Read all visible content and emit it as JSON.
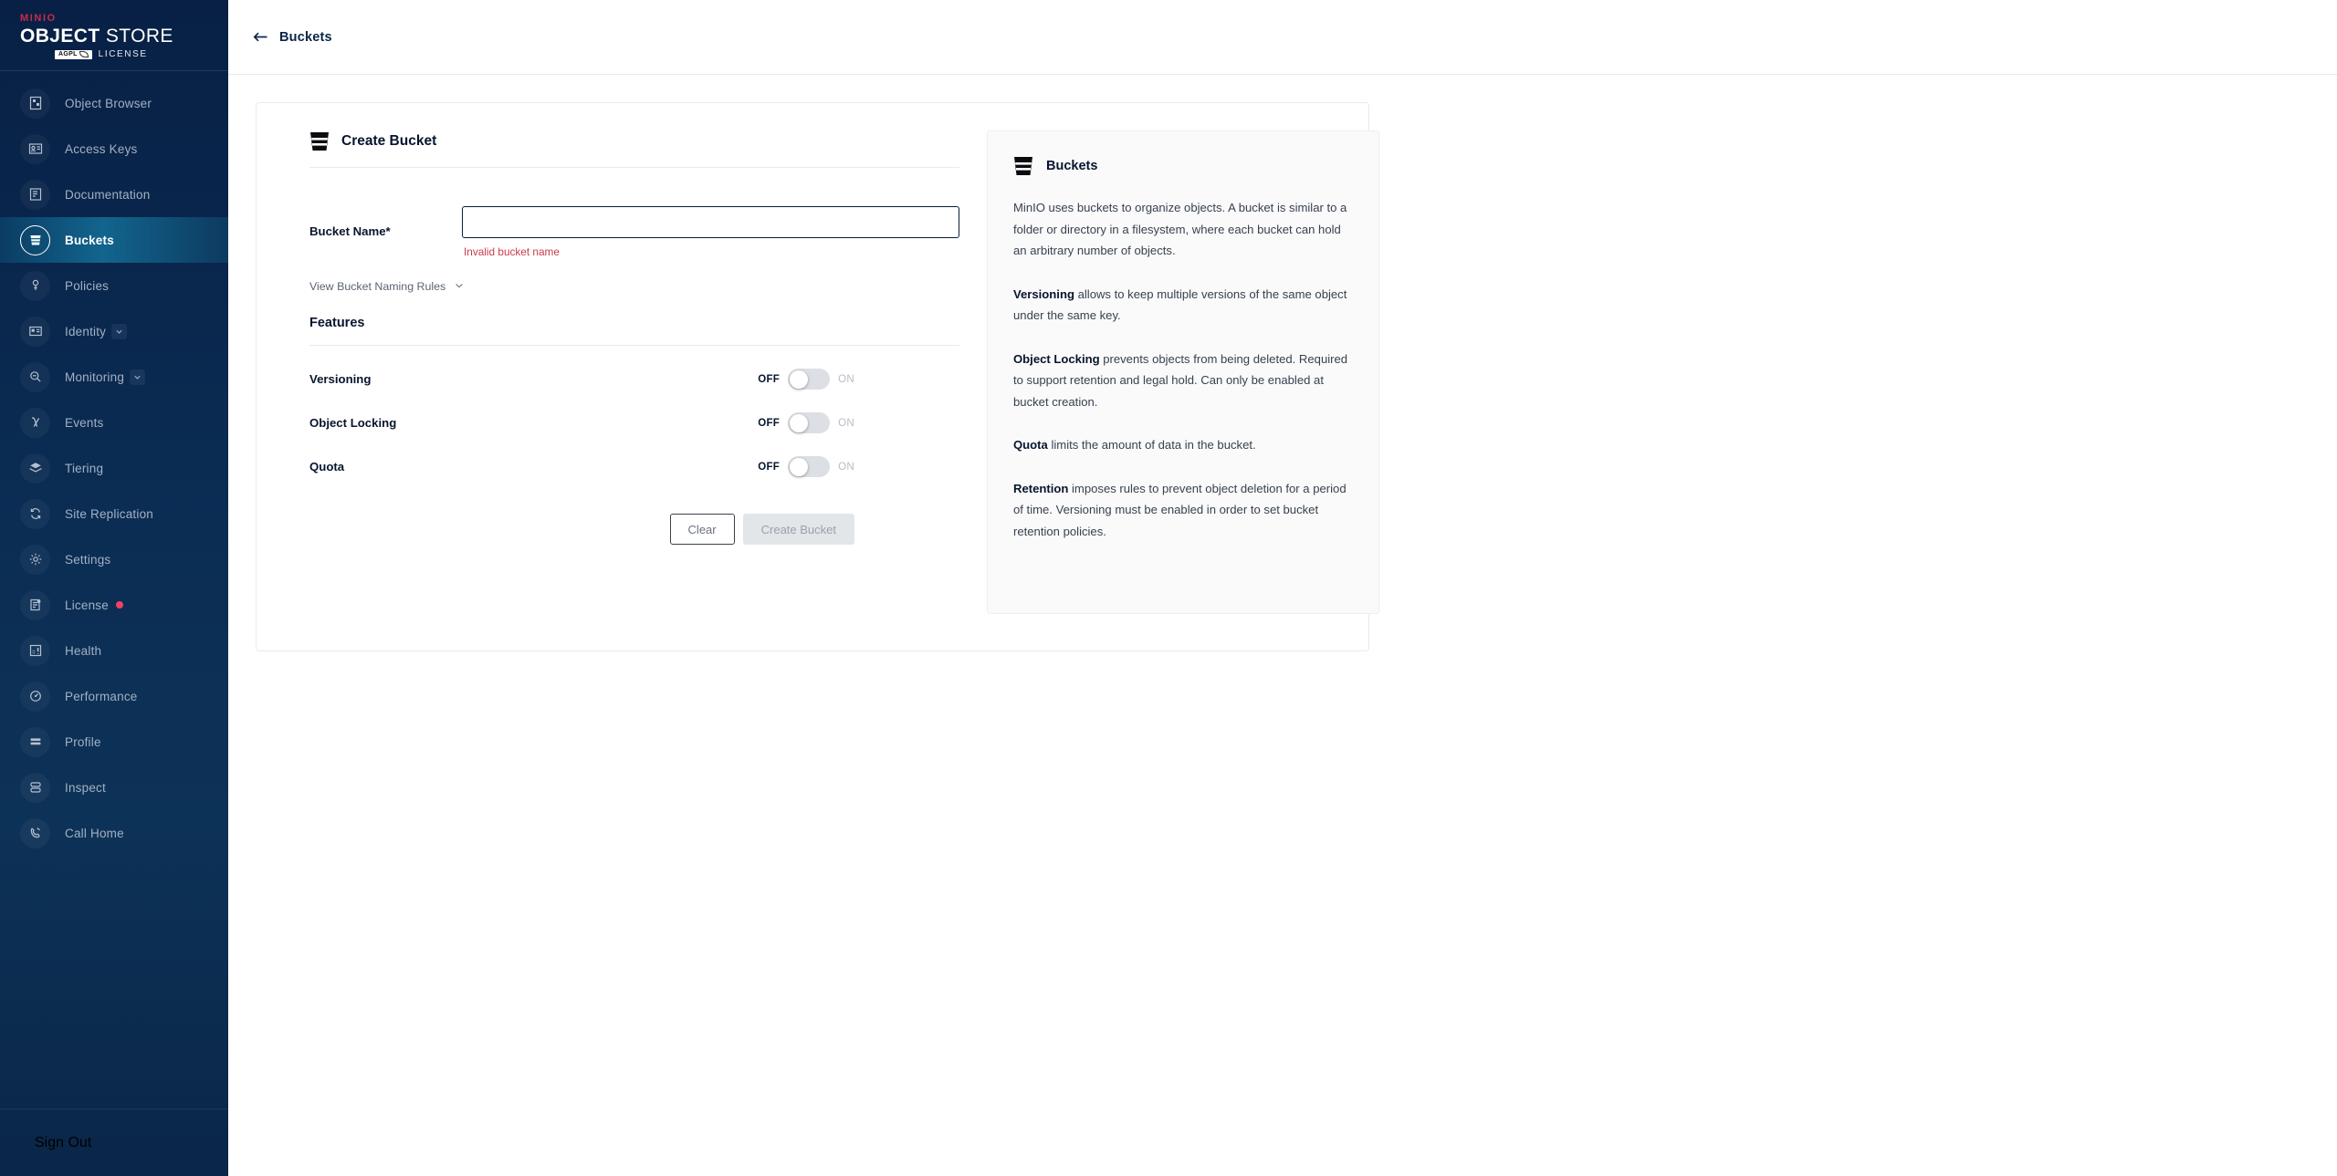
{
  "sidebar": {
    "logo": {
      "minio": "MINIO",
      "object_bold": "OBJECT",
      "store": " STORE",
      "agpl": "AGPL",
      "license_word": "LICENSE"
    },
    "items": [
      {
        "label": "Object Browser",
        "icon": "object-browser-icon",
        "active": false
      },
      {
        "label": "Access Keys",
        "icon": "access-keys-icon",
        "active": false
      },
      {
        "label": "Documentation",
        "icon": "documentation-icon",
        "active": false
      },
      {
        "label": "Buckets",
        "icon": "bucket-icon",
        "active": true
      },
      {
        "label": "Policies",
        "icon": "policies-icon",
        "active": false
      },
      {
        "label": "Identity",
        "icon": "identity-icon",
        "active": false
      },
      {
        "label": "Monitoring",
        "icon": "monitoring-icon",
        "active": false
      },
      {
        "label": "Events",
        "icon": "events-lambda-icon",
        "active": false
      },
      {
        "label": "Tiering",
        "icon": "tiering-layers-icon",
        "active": false
      },
      {
        "label": "Site Replication",
        "icon": "site-replication-icon",
        "active": false
      },
      {
        "label": "Settings",
        "icon": "gear-icon",
        "active": false
      },
      {
        "label": "License",
        "icon": "license-icon",
        "active": false
      },
      {
        "label": "Health",
        "icon": "health-icon",
        "active": false
      },
      {
        "label": "Performance",
        "icon": "performance-icon",
        "active": false
      },
      {
        "label": "Profile",
        "icon": "profile-icon",
        "active": false
      },
      {
        "label": "Inspect",
        "icon": "inspect-icon",
        "active": false
      },
      {
        "label": "Call Home",
        "icon": "call-home-icon",
        "active": false
      }
    ],
    "sign_out": {
      "label": "Sign Out",
      "icon": "sign-out-icon"
    }
  },
  "topbar": {
    "back_icon": "back-arrow-icon",
    "title": "Buckets"
  },
  "form": {
    "heading": "Create Bucket",
    "heading_icon": "bucket-icon",
    "bucket_name": {
      "label": "Bucket Name*",
      "value": "",
      "placeholder": "",
      "error": "Invalid bucket name"
    },
    "naming_rules": {
      "label": "View Bucket Naming Rules",
      "icon": "chevron-down-icon"
    },
    "features_heading": "Features",
    "toggles": [
      {
        "name": "Versioning",
        "off_label": "OFF",
        "on_label": "ON",
        "state": "off"
      },
      {
        "name": "Object Locking",
        "off_label": "OFF",
        "on_label": "ON",
        "state": "off"
      },
      {
        "name": "Quota",
        "off_label": "OFF",
        "on_label": "ON",
        "state": "off"
      }
    ],
    "buttons": {
      "clear": "Clear",
      "create": "Create Bucket",
      "create_disabled": true
    }
  },
  "info_panel": {
    "title": "Buckets",
    "icon": "bucket-icon",
    "paragraphs": [
      {
        "lead": "",
        "text": "MinIO uses buckets to organize objects. A bucket is similar to a folder or directory in a filesystem, where each bucket can hold an arbitrary number of objects."
      },
      {
        "lead": "Versioning",
        "text": " allows to keep multiple versions of the same object under the same key."
      },
      {
        "lead": "Object Locking",
        "text": " prevents objects from being deleted. Required to support retention and legal hold. Can only be enabled at bucket creation."
      },
      {
        "lead": "Quota",
        "text": " limits the amount of data in the bucket."
      },
      {
        "lead": "Retention",
        "text": " imposes rules to prevent object deletion for a period of time. Versioning must be enabled in order to set bucket retention policies."
      }
    ]
  },
  "colors": {
    "brand_red": "#C72C48",
    "sidebar_dark": "#082045",
    "active_teal": "#12658E",
    "error_red": "#C83B50",
    "badge_red": "#F2425F",
    "text_dark": "#07152E"
  }
}
